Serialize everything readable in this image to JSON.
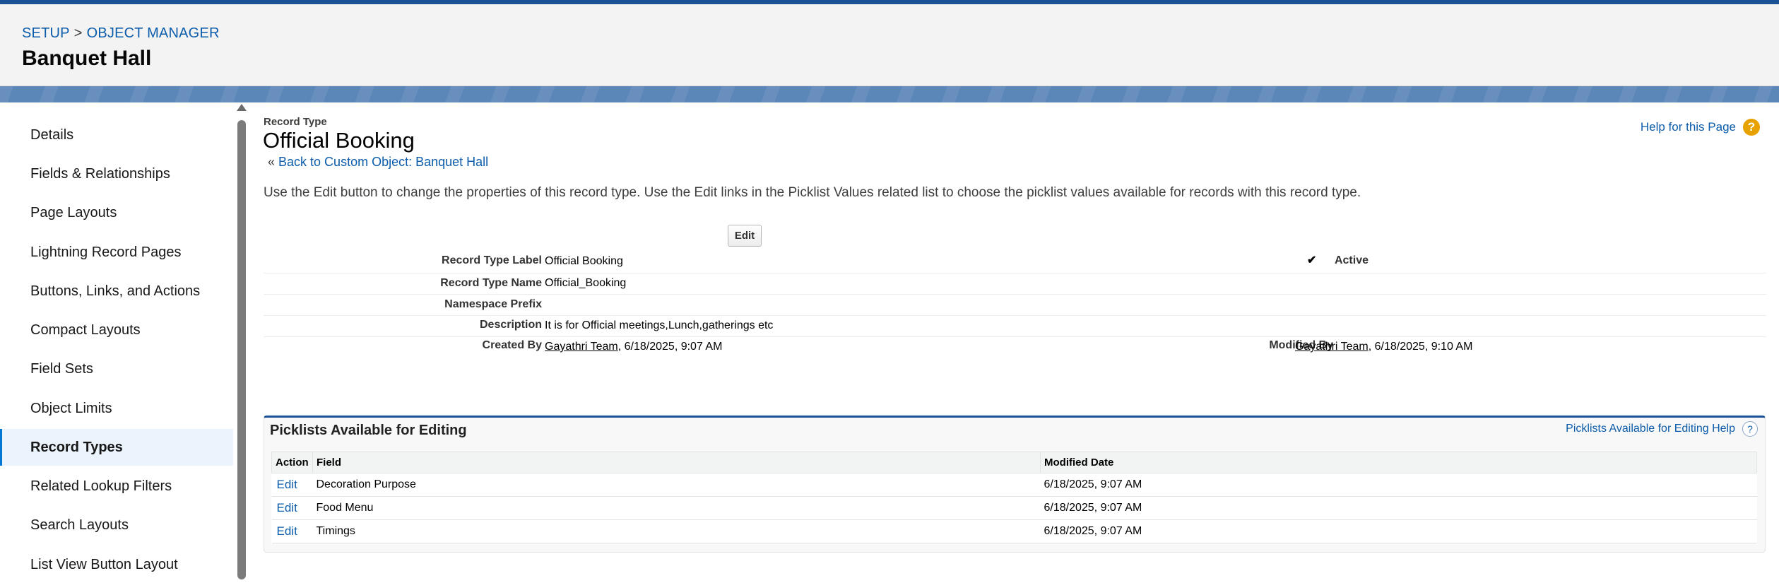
{
  "header": {
    "breadcrumb": [
      "SETUP",
      "OBJECT MANAGER"
    ],
    "breadcrumb_separator": ">",
    "title": "Banquet Hall"
  },
  "sidebar": {
    "items": [
      {
        "label": "Details"
      },
      {
        "label": "Fields & Relationships"
      },
      {
        "label": "Page Layouts"
      },
      {
        "label": "Lightning Record Pages"
      },
      {
        "label": "Buttons, Links, and Actions"
      },
      {
        "label": "Compact Layouts"
      },
      {
        "label": "Field Sets"
      },
      {
        "label": "Object Limits"
      },
      {
        "label": "Record Types",
        "active": true
      },
      {
        "label": "Related Lookup Filters"
      },
      {
        "label": "Search Layouts"
      },
      {
        "label": "List View Button Layout"
      }
    ]
  },
  "main": {
    "record_type_label": "Record Type",
    "title": "Official Booking",
    "back_prefix": "«",
    "back_link": "Back to Custom Object: Banquet Hall",
    "help_link": "Help for this Page",
    "help_icon": "?",
    "description": "Use the Edit button to change the properties of this record type. Use the Edit links in the Picklist Values related list to choose the picklist values available for records with this record type.",
    "edit_button": "Edit",
    "details": {
      "record_type_label": {
        "label": "Record Type Label",
        "value": "Official Booking"
      },
      "active": {
        "label": "Active",
        "value": "✔"
      },
      "record_type_name": {
        "label": "Record Type Name",
        "value": "Official_Booking"
      },
      "namespace_prefix": {
        "label": "Namespace Prefix",
        "value": ""
      },
      "description": {
        "label": "Description",
        "value": "It is for Official meetings,Lunch,gatherings etc"
      },
      "created_by": {
        "label": "Created By",
        "user": "Gayathri Team",
        "date": ", 6/18/2025, 9:07 AM"
      },
      "modified_by": {
        "label": "Modified By",
        "user": "Gayathri Team",
        "date": ", 6/18/2025, 9:10 AM"
      }
    }
  },
  "picklists": {
    "title": "Picklists Available for Editing",
    "help_link": "Picklists Available for Editing Help",
    "help_icon": "?",
    "columns": [
      "Action",
      "Field",
      "Modified Date"
    ],
    "rows": [
      {
        "action": "Edit",
        "field": "Decoration Purpose",
        "modified": "6/18/2025, 9:07 AM"
      },
      {
        "action": "Edit",
        "field": "Food Menu",
        "modified": "6/18/2025, 9:07 AM"
      },
      {
        "action": "Edit",
        "field": "Timings",
        "modified": "6/18/2025, 9:07 AM"
      }
    ]
  },
  "colors": {
    "brand_blue": "#1b5297",
    "link_blue": "#0b5cab",
    "active_bg": "#ebf3fd",
    "help_orange": "#e8a200"
  }
}
